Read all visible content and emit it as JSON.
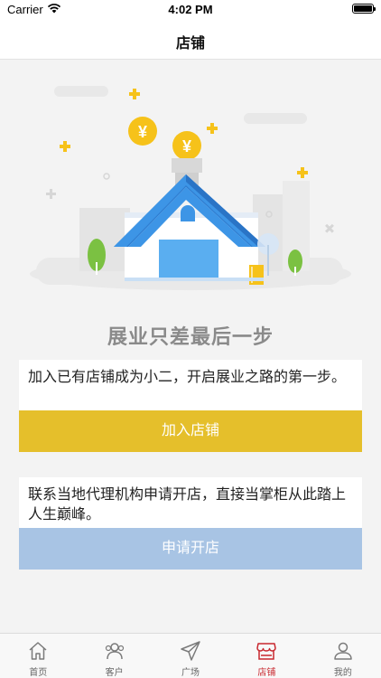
{
  "status_bar": {
    "carrier": "Carrier",
    "time": "4:02 PM"
  },
  "nav": {
    "title": "店铺"
  },
  "headline": "展业只差最后一步",
  "join_card": {
    "description": "加入已有店铺成为小二，开启展业之路的第一步。",
    "button_label": "加入店铺"
  },
  "apply_card": {
    "description": "联系当地代理机构申请开店，直接当掌柜从此踏上人生巅峰。",
    "button_label": "申请开店"
  },
  "tabbar": {
    "active": "店铺",
    "items": [
      {
        "label": "首页",
        "icon": "home-icon"
      },
      {
        "label": "客户",
        "icon": "customers-icon"
      },
      {
        "label": "广场",
        "icon": "paper-plane-icon"
      },
      {
        "label": "店铺",
        "icon": "shop-icon"
      },
      {
        "label": "我的",
        "icon": "profile-icon"
      }
    ]
  },
  "colors": {
    "join_button": "#e5bf2b",
    "apply_button": "#a8c4e4",
    "tab_active": "#c8272e",
    "roof": "#3d95e6",
    "coin": "#f6c21a"
  }
}
